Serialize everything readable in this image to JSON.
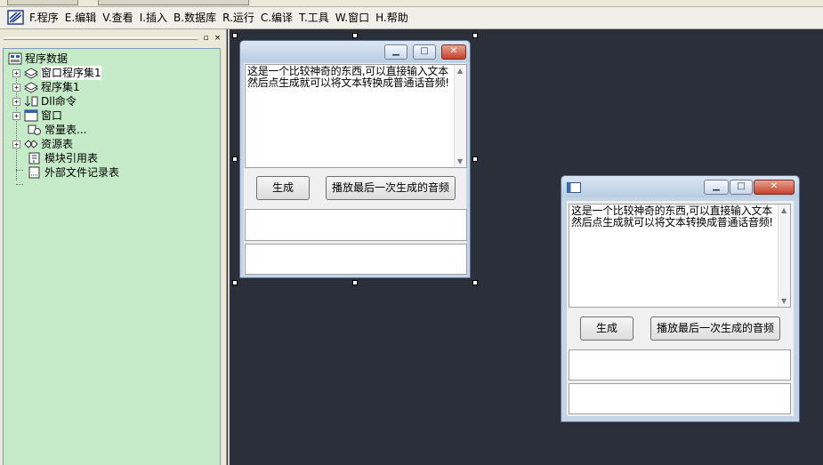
{
  "menu": {
    "items": [
      {
        "key": "F",
        "label": "F.程序"
      },
      {
        "key": "E",
        "label": "E.编辑"
      },
      {
        "key": "V",
        "label": "V.查看"
      },
      {
        "key": "I",
        "label": "I.插入"
      },
      {
        "key": "B",
        "label": "B.数据库"
      },
      {
        "key": "R",
        "label": "R.运行"
      },
      {
        "key": "C",
        "label": "C.编译"
      },
      {
        "key": "T",
        "label": "T.工具"
      },
      {
        "key": "W",
        "label": "W.窗口"
      },
      {
        "key": "H",
        "label": "H.帮助"
      }
    ]
  },
  "panel": {
    "restore_glyph": "▫",
    "close_glyph": "×"
  },
  "tree": {
    "root": "程序数据",
    "items": [
      {
        "label": "窗口程序集1",
        "icon": "assembly-icon",
        "expandable": true,
        "selected": true
      },
      {
        "label": "程序集1",
        "icon": "assembly-icon",
        "expandable": true,
        "selected": false
      },
      {
        "label": "Dll命令",
        "icon": "dll-icon",
        "expandable": true,
        "selected": false
      },
      {
        "label": "窗口",
        "icon": "window-icon",
        "expandable": true,
        "selected": false
      },
      {
        "label": "常量表...",
        "icon": "constant-icon",
        "expandable": false,
        "selected": false
      },
      {
        "label": "资源表",
        "icon": "resource-icon",
        "expandable": true,
        "selected": false
      },
      {
        "label": "模块引用表",
        "icon": "module-icon",
        "expandable": false,
        "selected": false
      },
      {
        "label": "外部文件记录表",
        "icon": "file-icon",
        "expandable": false,
        "selected": false
      }
    ]
  },
  "design_form": {
    "memo_text": "这是一个比较神奇的东西,可以直接输入文本然后点生成就可以将文本转换成普通话音频!",
    "btn_generate": "生成",
    "btn_play": "播放最后一次生成的音频"
  },
  "preview_form": {
    "memo_text": "这是一个比较神奇的东西,可以直接输入文本然后点生成就可以将文本转换成普通话音频!",
    "btn_generate": "生成",
    "btn_play": "播放最后一次生成的音频"
  },
  "colors": {
    "tree_bg": "#c6ebc9",
    "desktop_bg": "#2b2f3a",
    "close_red": "#c5432c"
  }
}
